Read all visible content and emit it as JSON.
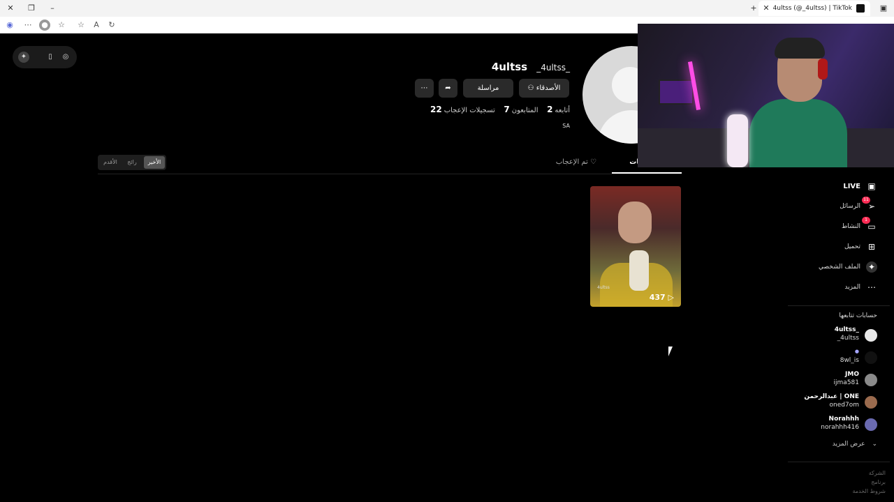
{
  "browser": {
    "tab_title": "4ultss (@_4ultss) | TikTok",
    "new_tab_icon": "plus-icon",
    "tab_close_icon": "close-icon"
  },
  "profile": {
    "nickname": "4ultss",
    "handle": "_4ultss_",
    "buttons": {
      "invite": "الأصدقاء",
      "message": "مراسلة"
    },
    "stats": [
      {
        "value": "2",
        "label": "أتابعه"
      },
      {
        "value": "7",
        "label": "المتابعون"
      },
      {
        "value": "22",
        "label": "تسجيلات الإعجاب"
      }
    ],
    "region": "SA"
  },
  "tabs": {
    "videos": "هات",
    "liked": "تم الإعجاب"
  },
  "sort": {
    "options": [
      "الأخير",
      "رائج",
      "الأقدم"
    ],
    "active": "الأخير"
  },
  "video": {
    "views": "437",
    "watermark": "4ultss"
  },
  "sidebar": {
    "nav": [
      {
        "label": "LIVE",
        "icon": "live-icon"
      },
      {
        "label": "الرسائل",
        "icon": "messages-icon",
        "badge": "11"
      },
      {
        "label": "النشاط",
        "icon": "activity-icon",
        "badge": "1"
      },
      {
        "label": "تحميل",
        "icon": "upload-icon"
      },
      {
        "label": "الملف الشخصي",
        "icon": "profile-icon"
      },
      {
        "label": "المزيد",
        "icon": "more-icon"
      }
    ],
    "following_title": "حسابات تتابعها",
    "following": [
      {
        "name": "4ultss_",
        "handle": "_4ultss",
        "color": "#e8e8e8"
      },
      {
        "name": "",
        "handle": "8wl_is",
        "color": "#222222"
      },
      {
        "name": "JMO",
        "handle": "ijma581",
        "color": "#8a8a8a"
      },
      {
        "name": "عبدالرحمن | ONE",
        "handle": "oned7om",
        "color": "#9b6b4e"
      },
      {
        "name": "Norahhh",
        "handle": "norahhh416",
        "color": "#6a6ab0"
      }
    ],
    "see_more": "عرض المزيد",
    "footer": [
      "الشركة",
      "برنامج",
      "شروط الخدمة"
    ]
  },
  "colors": {
    "accent": "#fe2c55",
    "background": "#000000"
  }
}
